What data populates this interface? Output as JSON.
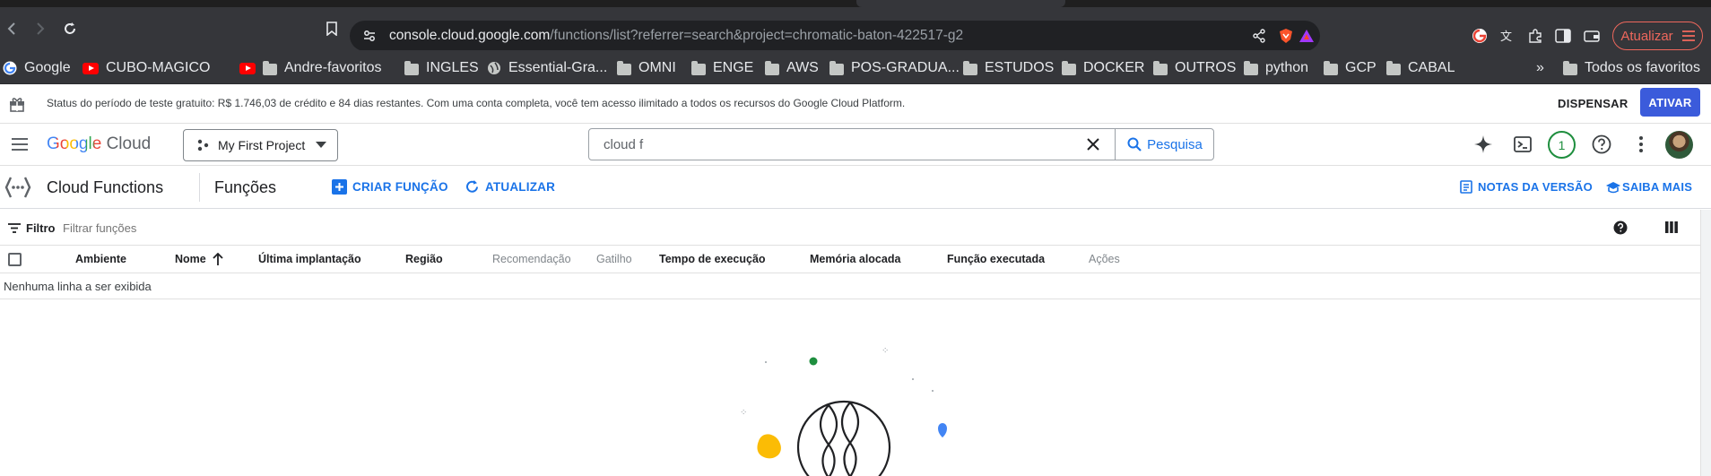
{
  "browser": {
    "url_host": "console.cloud.google.com",
    "url_path": "/functions/list?referrer=search&project=chromatic-baton-422517-g2",
    "update_label": "Atualizar"
  },
  "bookmarks": [
    {
      "label": "Google",
      "icon": "google-icon"
    },
    {
      "label": "CUBO-MAGICO",
      "icon": "youtube-icon"
    },
    {
      "label": "Andre-favoritos",
      "icon": "youtube-icon"
    },
    {
      "label": "INGLES",
      "icon": "folder-icon"
    },
    {
      "label": "Essential-Gra...",
      "icon": "globe-icon"
    },
    {
      "label": "OMNI",
      "icon": "folder-icon"
    },
    {
      "label": "ENGE",
      "icon": "folder-icon"
    },
    {
      "label": "AWS",
      "icon": "folder-icon"
    },
    {
      "label": "POS-GRADUA...",
      "icon": "folder-icon"
    },
    {
      "label": "ESTUDOS",
      "icon": "folder-icon"
    },
    {
      "label": "DOCKER",
      "icon": "folder-icon"
    },
    {
      "label": "OUTROS",
      "icon": "folder-icon"
    },
    {
      "label": "python",
      "icon": "folder-icon"
    },
    {
      "label": "GCP",
      "icon": "folder-icon"
    },
    {
      "label": "CABAL",
      "icon": "folder-icon"
    }
  ],
  "bookmarks_more": "»",
  "bookmarks_all": "Todos os favoritos",
  "trial": {
    "text": "Status do período de teste gratuito: R$ 1.746,03 de crédito e 84 dias restantes. Com uma conta completa, você tem acesso ilimitado a todos os recursos do Google Cloud Platform.",
    "dismiss": "DISPENSAR",
    "activate": "ATIVAR"
  },
  "gcp": {
    "logo_google": "Google",
    "logo_cloud": "Cloud",
    "project": "My First Project",
    "search_value": "cloud f",
    "search_button": "Pesquisa",
    "notifications_count": "1"
  },
  "page": {
    "product": "Cloud Functions",
    "section": "Funções",
    "create": "CRIAR FUNÇÃO",
    "refresh": "ATUALIZAR",
    "release_notes": "NOTAS DA VERSÃO",
    "learn_more": "SAIBA MAIS"
  },
  "filter": {
    "label": "Filtro",
    "placeholder": "Filtrar funções"
  },
  "table": {
    "columns": [
      "Ambiente",
      "Nome",
      "Última implantação",
      "Região",
      "Recomendação",
      "Gatilho",
      "Tempo de execução",
      "Memória alocada",
      "Função executada",
      "Ações"
    ],
    "empty": "Nenhuma linha a ser exibida"
  },
  "colors": {
    "accent": "#1a73e8",
    "activate_bg": "#3b5bdb",
    "chrome_dark": "#35363a",
    "update_red": "#ee675c"
  }
}
